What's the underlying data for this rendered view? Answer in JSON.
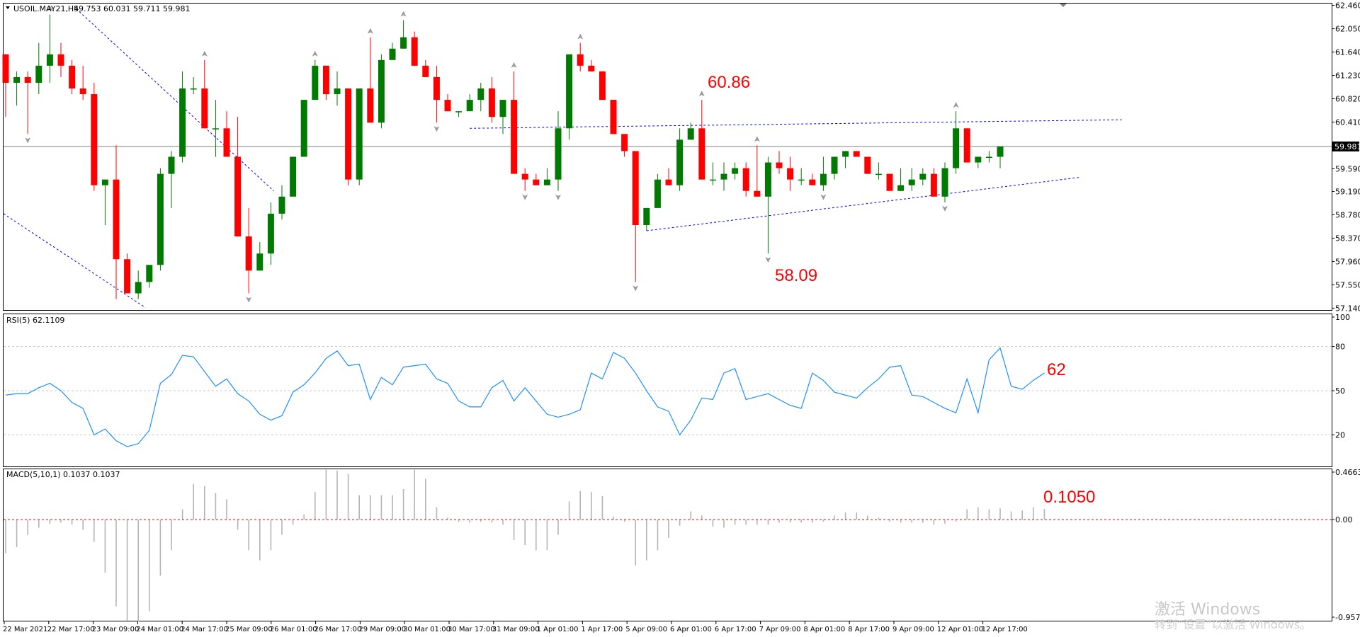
{
  "header": {
    "main_title": "USOIL.MAY21,H4",
    "ohlc": "59.753 60.031 59.711 59.981",
    "rsi_title": "RSI(5) 62.1109",
    "macd_title": "MACD(5,10,1) 0.1037 0.1037"
  },
  "colors": {
    "bull": "#007a00",
    "bear": "#ff0000",
    "rsi_line": "#1e90ff",
    "trend": "#0000ff",
    "hist": "#b4b4b4",
    "macd_zero": "#ff0000"
  },
  "annotations": {
    "high": "60.86",
    "low": "58.09",
    "rsi": "62",
    "macd": "0.1050"
  },
  "watermark": {
    "line1": "激活 Windows",
    "line2": "转到“设置”以激活 Windows。"
  },
  "chart_data": [
    {
      "type": "candlestick",
      "title": "USOIL.MAY21,H4",
      "y_ticks": [
        "62.460",
        "62.050",
        "61.640",
        "61.230",
        "60.820",
        "60.410",
        "59.981",
        "59.590",
        "59.190",
        "58.780",
        "58.370",
        "57.960",
        "57.550",
        "57.140"
      ],
      "ylim": [
        57.12,
        62.48
      ],
      "current_price": 59.981,
      "ohlc": [
        [
          61.6,
          61.6,
          60.5,
          61.1
        ],
        [
          61.1,
          61.3,
          60.7,
          61.2
        ],
        [
          61.2,
          61.3,
          60.2,
          61.1
        ],
        [
          61.1,
          61.8,
          60.9,
          61.4
        ],
        [
          61.4,
          62.3,
          61.1,
          61.6
        ],
        [
          61.6,
          61.8,
          61.2,
          61.4
        ],
        [
          61.4,
          61.5,
          60.9,
          61.0
        ],
        [
          61.0,
          61.4,
          60.8,
          60.9
        ],
        [
          60.9,
          61.1,
          59.2,
          59.3
        ],
        [
          59.3,
          59.4,
          58.6,
          59.4
        ],
        [
          59.4,
          60.0,
          57.3,
          58.0
        ],
        [
          58.0,
          58.1,
          57.4,
          57.4
        ],
        [
          57.4,
          57.8,
          57.3,
          57.6
        ],
        [
          57.6,
          57.9,
          57.5,
          57.9
        ],
        [
          57.9,
          59.6,
          57.8,
          59.5
        ],
        [
          59.5,
          59.9,
          58.9,
          59.8
        ],
        [
          59.8,
          61.3,
          59.7,
          61.0
        ],
        [
          61.0,
          61.2,
          60.9,
          61.0
        ],
        [
          61.0,
          61.5,
          60.3,
          60.3
        ],
        [
          60.3,
          60.8,
          59.8,
          60.3
        ],
        [
          60.3,
          60.6,
          59.8,
          59.8
        ],
        [
          59.8,
          60.5,
          58.7,
          58.4
        ],
        [
          58.4,
          58.9,
          57.4,
          57.8
        ],
        [
          57.8,
          58.3,
          57.9,
          58.1
        ],
        [
          58.1,
          59.0,
          57.9,
          58.8
        ],
        [
          58.8,
          59.3,
          58.7,
          59.1
        ],
        [
          59.1,
          59.7,
          59.1,
          59.8
        ],
        [
          59.8,
          60.6,
          59.8,
          60.8
        ],
        [
          60.8,
          61.5,
          60.9,
          61.4
        ],
        [
          61.4,
          61.4,
          60.8,
          60.9
        ],
        [
          60.9,
          61.3,
          60.7,
          61.0
        ],
        [
          61.0,
          61.0,
          59.3,
          59.4
        ],
        [
          59.4,
          60.9,
          59.3,
          61.0
        ],
        [
          61.0,
          61.9,
          60.4,
          60.4
        ],
        [
          60.4,
          61.6,
          60.3,
          61.5
        ],
        [
          61.5,
          61.8,
          61.6,
          61.7
        ],
        [
          61.7,
          62.2,
          61.8,
          61.9
        ],
        [
          61.9,
          62.0,
          61.5,
          61.4
        ],
        [
          61.4,
          61.5,
          61.2,
          61.2
        ],
        [
          61.2,
          61.4,
          60.4,
          60.8
        ],
        [
          60.8,
          60.9,
          60.6,
          60.6
        ],
        [
          60.6,
          60.6,
          60.5,
          60.6
        ],
        [
          60.6,
          60.9,
          60.6,
          60.8
        ],
        [
          60.8,
          61.1,
          60.6,
          61.0
        ],
        [
          61.0,
          61.2,
          60.4,
          60.5
        ],
        [
          60.5,
          60.6,
          60.2,
          60.8
        ],
        [
          60.8,
          61.3,
          59.6,
          59.5
        ],
        [
          59.5,
          59.6,
          59.2,
          59.4
        ],
        [
          59.4,
          59.5,
          59.3,
          59.3
        ],
        [
          59.3,
          59.6,
          59.4,
          59.4
        ],
        [
          59.4,
          60.6,
          59.2,
          60.3
        ],
        [
          60.3,
          61.6,
          60.1,
          61.6
        ],
        [
          61.6,
          61.8,
          61.3,
          61.4
        ],
        [
          61.4,
          61.5,
          61.3,
          61.3
        ],
        [
          61.3,
          61.3,
          60.8,
          60.8
        ],
        [
          60.8,
          60.8,
          60.2,
          60.2
        ],
        [
          60.2,
          60.1,
          59.8,
          59.9
        ],
        [
          59.9,
          59.9,
          57.6,
          58.6
        ],
        [
          58.6,
          58.8,
          58.5,
          58.9
        ],
        [
          58.9,
          59.5,
          59.0,
          59.4
        ],
        [
          59.4,
          59.6,
          59.3,
          59.3
        ],
        [
          59.3,
          60.3,
          59.2,
          60.1
        ],
        [
          60.1,
          60.4,
          60.1,
          60.3
        ],
        [
          60.3,
          60.8,
          59.4,
          59.4
        ],
        [
          59.4,
          59.7,
          59.3,
          59.4
        ],
        [
          59.4,
          59.7,
          59.2,
          59.5
        ],
        [
          59.5,
          59.7,
          59.4,
          59.6
        ],
        [
          59.6,
          59.7,
          59.1,
          59.2
        ],
        [
          59.2,
          60.0,
          59.1,
          59.1
        ],
        [
          59.1,
          59.8,
          58.1,
          59.7
        ],
        [
          59.7,
          59.9,
          59.5,
          59.6
        ],
        [
          59.6,
          59.8,
          59.2,
          59.4
        ],
        [
          59.4,
          59.6,
          59.3,
          59.4
        ],
        [
          59.4,
          59.5,
          59.3,
          59.3
        ],
        [
          59.3,
          59.8,
          59.2,
          59.5
        ],
        [
          59.5,
          59.8,
          59.4,
          59.8
        ],
        [
          59.8,
          59.9,
          59.6,
          59.9
        ],
        [
          59.9,
          59.9,
          59.8,
          59.8
        ],
        [
          59.8,
          59.8,
          59.5,
          59.5
        ],
        [
          59.5,
          59.7,
          59.4,
          59.5
        ],
        [
          59.5,
          59.5,
          59.3,
          59.2
        ],
        [
          59.2,
          59.6,
          59.2,
          59.3
        ],
        [
          59.3,
          59.6,
          59.2,
          59.4
        ],
        [
          59.4,
          59.6,
          59.3,
          59.5
        ],
        [
          59.5,
          59.6,
          59.1,
          59.1
        ],
        [
          59.1,
          59.7,
          59.0,
          59.6
        ],
        [
          59.6,
          60.6,
          59.5,
          60.3
        ],
        [
          60.3,
          60.3,
          59.7,
          59.7
        ],
        [
          59.7,
          59.8,
          59.6,
          59.8
        ],
        [
          59.8,
          59.9,
          59.7,
          59.8
        ],
        [
          59.8,
          59.9,
          59.6,
          59.981
        ]
      ],
      "annotations": [
        {
          "label": "60.86",
          "x": 41,
          "y": 60.86
        },
        {
          "label": "58.09",
          "x": 57,
          "y": 58.09
        }
      ]
    },
    {
      "type": "line",
      "title": "RSI(5) 62.1109",
      "y_ticks": [
        100,
        80,
        50,
        20
      ],
      "ylim": [
        0,
        100
      ],
      "levels": [
        80,
        50,
        20
      ],
      "values": [
        47,
        48,
        48,
        52,
        55,
        50,
        42,
        38,
        20,
        24,
        16,
        12,
        14,
        23,
        55,
        61,
        74,
        73,
        63,
        53,
        58,
        48,
        43,
        34,
        30,
        33,
        49,
        54,
        62,
        72,
        77,
        67,
        68,
        44,
        59,
        54,
        66,
        67,
        68,
        58,
        55,
        43,
        39,
        39,
        52,
        57,
        43,
        52,
        43,
        34,
        32,
        34,
        37,
        62,
        58,
        76,
        72,
        62,
        50,
        39,
        36,
        20,
        30,
        45,
        44,
        62,
        65,
        44,
        46,
        48,
        44,
        40,
        38,
        62,
        57,
        49,
        47,
        45,
        52,
        58,
        66,
        67,
        47,
        46,
        42,
        38,
        35,
        58,
        35,
        71,
        79,
        53,
        51,
        57,
        62
      ]
    },
    {
      "type": "bar",
      "title": "MACD(5,10,1) 0.1037 0.1037",
      "y_ticks": [
        "0.4663",
        "0.00",
        "-0.9579"
      ],
      "ylim": [
        -0.9579,
        0.4663
      ],
      "values": [
        -0.33,
        -0.27,
        -0.15,
        -0.08,
        -0.04,
        -0.03,
        -0.05,
        -0.1,
        -0.22,
        -0.52,
        -0.85,
        -0.99,
        -1.0,
        -0.9,
        -0.55,
        -0.3,
        0.1,
        0.35,
        0.33,
        0.26,
        0.2,
        -0.1,
        -0.3,
        -0.4,
        -0.3,
        -0.15,
        -0.05,
        0.05,
        0.27,
        0.49,
        0.48,
        0.45,
        0.24,
        0.24,
        0.24,
        0.24,
        0.3,
        0.49,
        0.4,
        0.12,
        0.02,
        -0.02,
        -0.03,
        -0.02,
        -0.03,
        -0.05,
        -0.2,
        -0.25,
        -0.3,
        -0.3,
        -0.15,
        0.18,
        0.28,
        0.27,
        0.23,
        0.03,
        -0.02,
        -0.45,
        -0.4,
        -0.3,
        -0.18,
        -0.06,
        0.08,
        0.04,
        -0.07,
        -0.08,
        -0.05,
        -0.05,
        -0.05,
        -0.05,
        -0.03,
        -0.03,
        -0.03,
        -0.03,
        -0.02,
        0.04,
        0.07,
        0.07,
        0.04,
        0.02,
        -0.02,
        -0.03,
        -0.03,
        -0.03,
        -0.05,
        -0.04,
        -0.02,
        0.1,
        0.12,
        0.1,
        0.11,
        0.08,
        0.09,
        0.12,
        0.105
      ]
    }
  ],
  "x_axis_labels": [
    "22 Mar 2021",
    "22 Mar 17:00",
    "23 Mar 09:00",
    "24 Mar 01:00",
    "24 Mar 17:00",
    "25 Mar 09:00",
    "26 Mar 01:00",
    "26 Mar 17:00",
    "29 Mar 09:00",
    "30 Mar 01:00",
    "30 Mar 17:00",
    "31 Mar 09:00",
    "1 Apr 01:00",
    "1 Apr 17:00",
    "5 Apr 09:00",
    "6 Apr 01:00",
    "6 Apr 17:00",
    "7 Apr 09:00",
    "8 Apr 01:00",
    "8 Apr 17:00",
    "9 Apr 09:00",
    "12 Apr 01:00",
    "12 Apr 17:00"
  ]
}
